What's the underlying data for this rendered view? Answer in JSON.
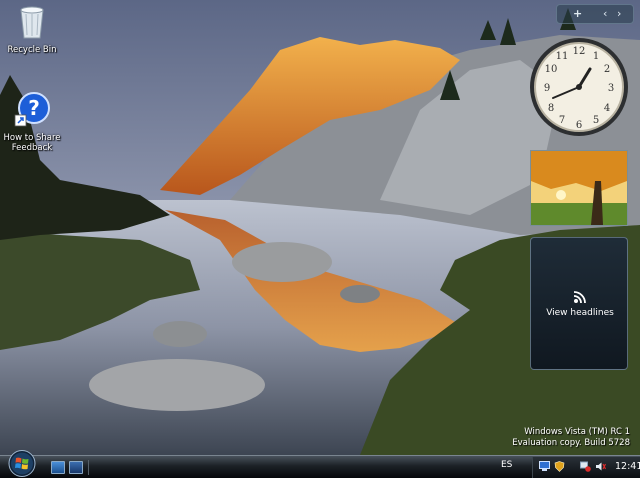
{
  "desktop": {
    "icons": [
      {
        "label": "Recycle Bin",
        "icon": "recycle-bin-icon"
      },
      {
        "label": "How to Share Feedback",
        "icon": "help-question-icon"
      }
    ]
  },
  "sidebar": {
    "controls": {
      "add": "+",
      "prev": "‹",
      "next": "›"
    },
    "clock": {
      "time_shown": "1:41"
    },
    "feed_headlines": {
      "label": "View headlines",
      "icon": "rss-feed-icon"
    }
  },
  "watermark": {
    "line1": "Windows Vista (TM) RC 1",
    "line2": "Evaluation copy. Build 5728"
  },
  "taskbar": {
    "start_icon": "windows-orb-icon",
    "quick_launch": [
      "show-desktop-icon",
      "switch-windows-icon"
    ],
    "language": "ES",
    "tray_icons": [
      "network-icon",
      "security-shield-icon",
      "network-status-icon",
      "volume-icon"
    ],
    "time": "12:41"
  },
  "colors": {
    "accent": "#3a7bd5",
    "taskbar": "#1c2126",
    "sky": "#8f9bb4",
    "sunlit_rock": "#e08a2c"
  }
}
